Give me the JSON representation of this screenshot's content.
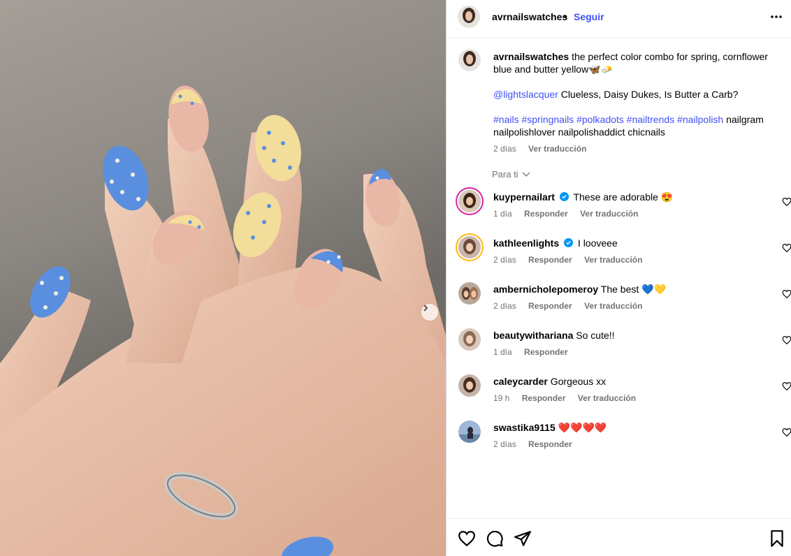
{
  "post": {
    "username": "avrnailswatches",
    "separator": "•",
    "follow_label": "Seguir",
    "more_icon": "more-options-icon"
  },
  "caption": {
    "username": "avrnailswatches",
    "text": "the perfect color combo for spring, cornflower blue and butter yellow🦋🧈",
    "mention": "@lightslacquer",
    "mention_text": "Clueless, Daisy Dukes, Is Butter a Carb?",
    "hashtags": "#nails #springnails #polkadots #nailtrends #nailpolish",
    "tags_plain": "nailgram nailpolishlover nailpolishaddict chicnails",
    "time": "2 días",
    "translate": "Ver traducción"
  },
  "para_ti": "Para ti",
  "comments": [
    {
      "username": "kuypernailart",
      "verified": true,
      "text": "These are adorable 😍",
      "time": "1 día",
      "reply": "Responder",
      "translate": "Ver traducción"
    },
    {
      "username": "kathleenlights",
      "verified": true,
      "text": "I looveee",
      "time": "2 días",
      "reply": "Responder",
      "translate": "Ver traducción"
    },
    {
      "username": "ambernicholepomeroy",
      "verified": false,
      "text": "The best 💙💛",
      "time": "2 días",
      "reply": "Responder",
      "translate": "Ver traducción"
    },
    {
      "username": "beautywithariana",
      "verified": false,
      "text": "So cute!!",
      "time": "1 día",
      "reply": "Responder",
      "translate": ""
    },
    {
      "username": "caleycarder",
      "verified": false,
      "text": "Gorgeous xx",
      "time": "19 h",
      "reply": "Responder",
      "translate": "Ver traducción"
    },
    {
      "username": "swastika9115",
      "verified": false,
      "text": "❤️❤️❤️❤️",
      "time": "2 días",
      "reply": "Responder",
      "translate": ""
    }
  ],
  "colors": {
    "link": "#4150f7",
    "muted": "#737373",
    "nail_blue": "#5a8fe0",
    "nail_yellow": "#f3dd9a"
  }
}
